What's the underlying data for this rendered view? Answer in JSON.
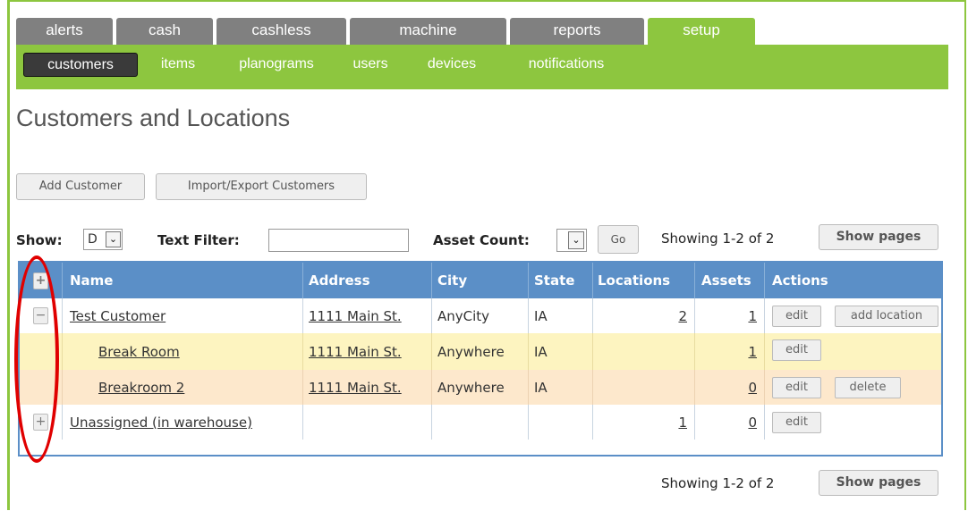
{
  "colors": {
    "accent_green": "#8dc63f",
    "tab_gray": "#808080",
    "table_blue": "#5b8fc7",
    "callout_red": "#e00000",
    "row_yellow": "#fdf4c0",
    "row_peach": "#fde8cc"
  },
  "top_tabs": [
    "alerts",
    "cash",
    "cashless",
    "machine",
    "reports",
    "setup"
  ],
  "sub_nav": [
    "customers",
    "items",
    "planograms",
    "users",
    "devices",
    "notifications"
  ],
  "page_title": "Customers and Locations",
  "buttons": {
    "add_customer": "Add Customer",
    "import_export": "Import/Export Customers",
    "go": "Go",
    "show_pages": "Show pages"
  },
  "filters": {
    "show_label": "Show:",
    "show_value": "D",
    "text_filter_label": "Text Filter:",
    "text_filter_value": "",
    "asset_count_label": "Asset Count:",
    "showing": "Showing 1-2 of 2"
  },
  "table": {
    "expand_all": "+",
    "columns": [
      "Name",
      "Address",
      "City",
      "State",
      "Locations",
      "Assets",
      "Actions"
    ],
    "rows": [
      {
        "expander": "−",
        "name": "Test Customer",
        "address": "1111 Main St.",
        "city": "AnyCity",
        "state": "IA",
        "locations": "2",
        "assets": "1",
        "actions": [
          "edit",
          "add location"
        ]
      },
      {
        "expander": "",
        "name": "Break Room",
        "address": "1111 Main St.",
        "city": "Anywhere",
        "state": "IA",
        "locations": "",
        "assets": "1",
        "actions": [
          "edit"
        ]
      },
      {
        "expander": "",
        "name": "Breakroom 2",
        "address": "1111 Main St.",
        "city": "Anywhere",
        "state": "IA",
        "locations": "",
        "assets": "0",
        "actions": [
          "edit",
          "delete"
        ]
      },
      {
        "expander": "+",
        "name": "Unassigned (in warehouse)",
        "address": "",
        "city": "",
        "state": "",
        "locations": "1",
        "assets": "0",
        "actions": [
          "edit"
        ]
      }
    ]
  },
  "footer": {
    "showing": "Showing 1-2 of 2"
  }
}
